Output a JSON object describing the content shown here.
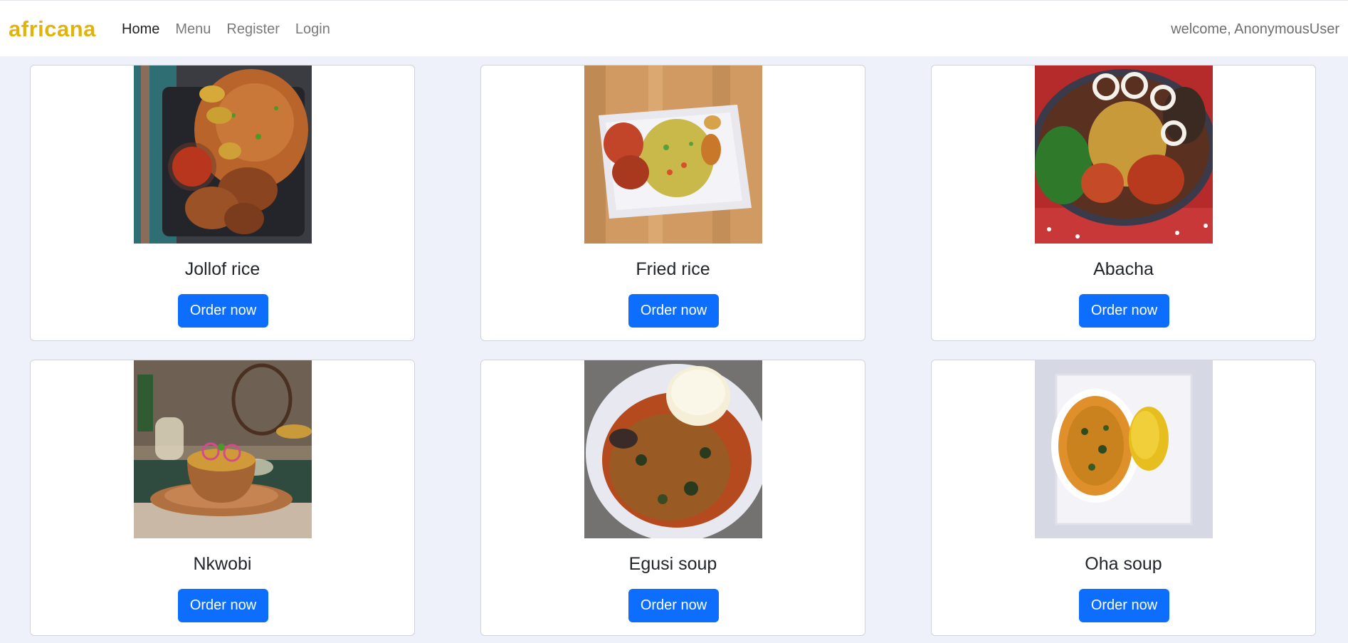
{
  "navbar": {
    "brand": "africana",
    "links": [
      {
        "label": "Home",
        "active": true
      },
      {
        "label": "Menu",
        "active": false
      },
      {
        "label": "Register",
        "active": false
      },
      {
        "label": "Login",
        "active": false
      }
    ],
    "welcome": "welcome, AnonymousUser"
  },
  "colors": {
    "brand": "#e0b40c",
    "button": "#0d6efd",
    "page_background": "#eef1f9"
  },
  "dishes": [
    {
      "name": "Jollof rice",
      "button": "Order now"
    },
    {
      "name": "Fried rice",
      "button": "Order now"
    },
    {
      "name": "Abacha",
      "button": "Order now"
    },
    {
      "name": "Nkwobi",
      "button": "Order now"
    },
    {
      "name": "Egusi soup",
      "button": "Order now"
    },
    {
      "name": "Oha soup",
      "button": "Order now"
    }
  ]
}
